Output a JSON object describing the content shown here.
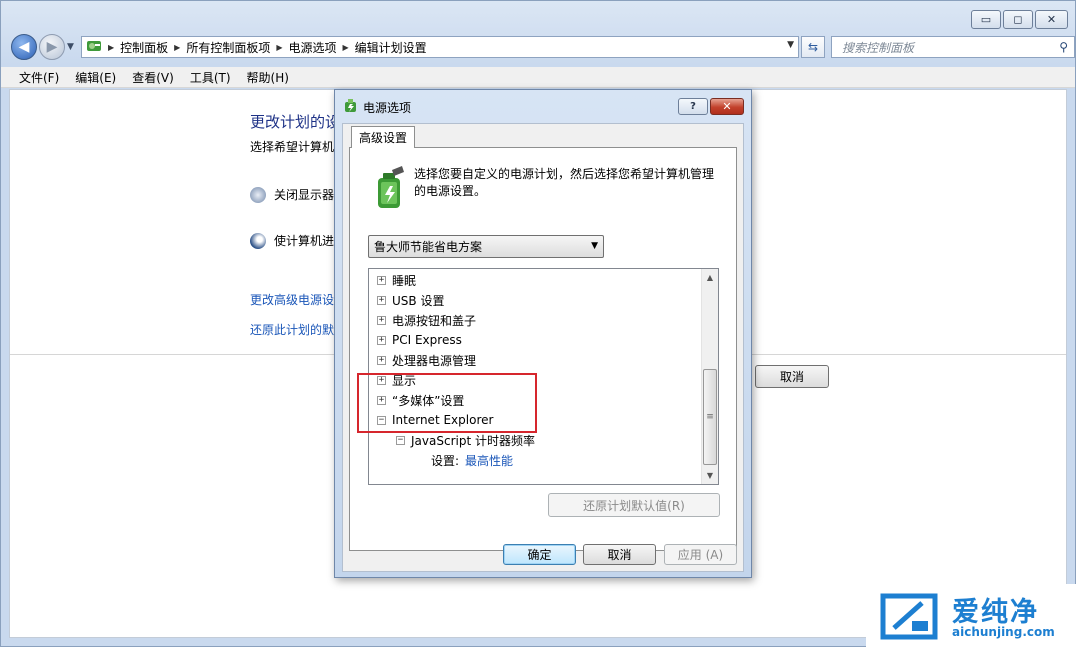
{
  "window": {
    "caption_buttons": {
      "minimize": "▭",
      "maximize": "◻",
      "close": "✕"
    }
  },
  "address_bar": {
    "segments": [
      "控制面板",
      "所有控制面板项",
      "电源选项",
      "编辑计划设置"
    ]
  },
  "search": {
    "placeholder": "搜索控制面板",
    "icon": "search-icon"
  },
  "menu": [
    "文件(F)",
    "编辑(E)",
    "查看(V)",
    "工具(T)",
    "帮助(H)"
  ],
  "background_page": {
    "title": "更改计划的设",
    "subtitle": "选择希望计算机使",
    "setting_display": "关闭显示器:",
    "setting_sleep": "使计算机进入",
    "link_advanced": "更改高级电源设",
    "link_restore": "还原此计划的默认",
    "cancel": "取消"
  },
  "dialog": {
    "title": "电源选项",
    "help": "?",
    "close": "✕",
    "tab": "高级设置",
    "intro": "选择您要自定义的电源计划，然后选择您希望计算机管理的电源设置。",
    "plan_selected": "鲁大师节能省电方案",
    "tree": [
      {
        "sign": "+",
        "label": "睡眠"
      },
      {
        "sign": "+",
        "label": "USB 设置"
      },
      {
        "sign": "+",
        "label": "电源按钮和盖子"
      },
      {
        "sign": "+",
        "label": "PCI Express"
      },
      {
        "sign": "+",
        "label": "处理器电源管理"
      },
      {
        "sign": "+",
        "label": "显示"
      },
      {
        "sign": "+",
        "label": "“多媒体”设置"
      },
      {
        "sign": "−",
        "label": "Internet Explorer"
      },
      {
        "sign": "−",
        "label": "JavaScript 计时器频率"
      }
    ],
    "setting_label": "设置:",
    "setting_value": "最高性能",
    "restore_button": "还原计划默认值(R)",
    "ok": "确定",
    "cancel": "取消",
    "apply": "应用 (A)"
  },
  "watermark": {
    "name": "爱纯净",
    "url": "aichunjing.com"
  },
  "colors": {
    "link": "#1a56b8",
    "highlight_box": "#d6262d",
    "watermark": "#1d7fd1"
  }
}
